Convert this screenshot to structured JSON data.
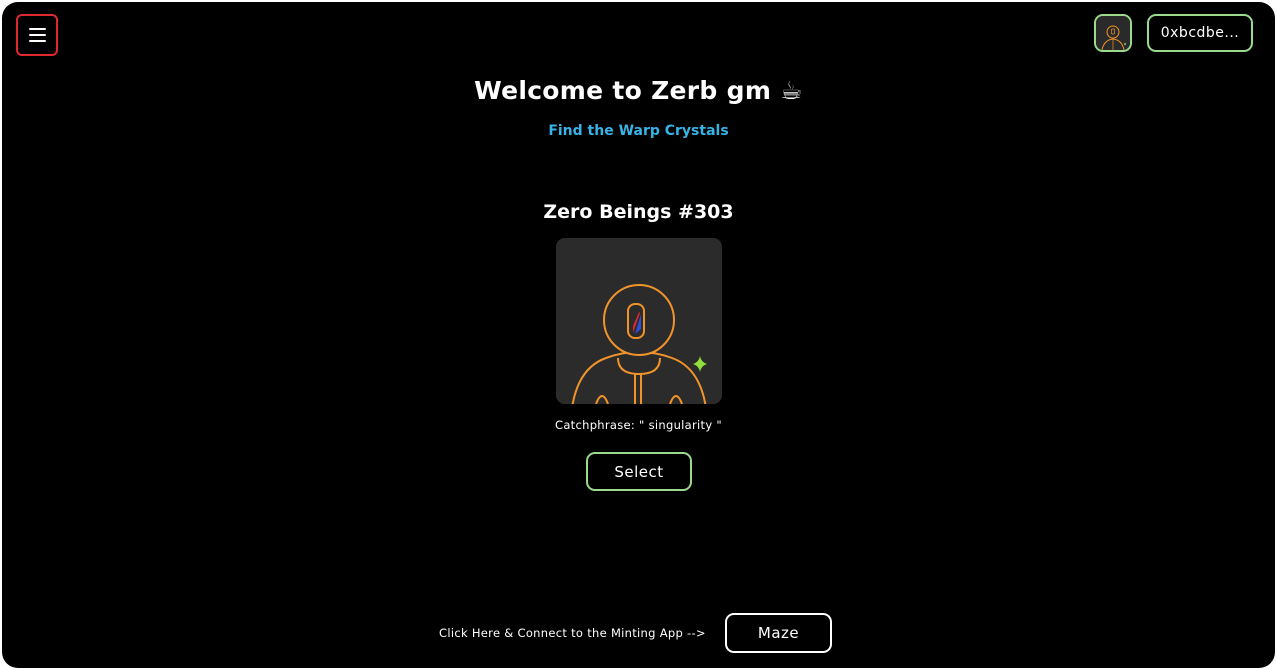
{
  "header": {
    "menu_icon": "hamburger-menu-icon",
    "avatar_icon": "zero-being-avatar-icon",
    "wallet_label": "0xbcdbe..."
  },
  "main": {
    "title": "Welcome to Zerb gm ☕",
    "subtitle": "Find the Warp Crystals",
    "nft_name": "Zero Beings #303",
    "nft_image_icon": "astronaut-nft-image",
    "catchphrase": "Catchphrase: \" singularity \"",
    "select_label": "Select"
  },
  "footer": {
    "connect_text": "Click Here & Connect to the Minting App -->",
    "maze_label": "Maze"
  },
  "colors": {
    "background": "#000000",
    "accent_green": "#9bd98c",
    "accent_red": "#e0282e",
    "link_blue": "#37b3e6",
    "nft_orange": "#f0932b"
  }
}
